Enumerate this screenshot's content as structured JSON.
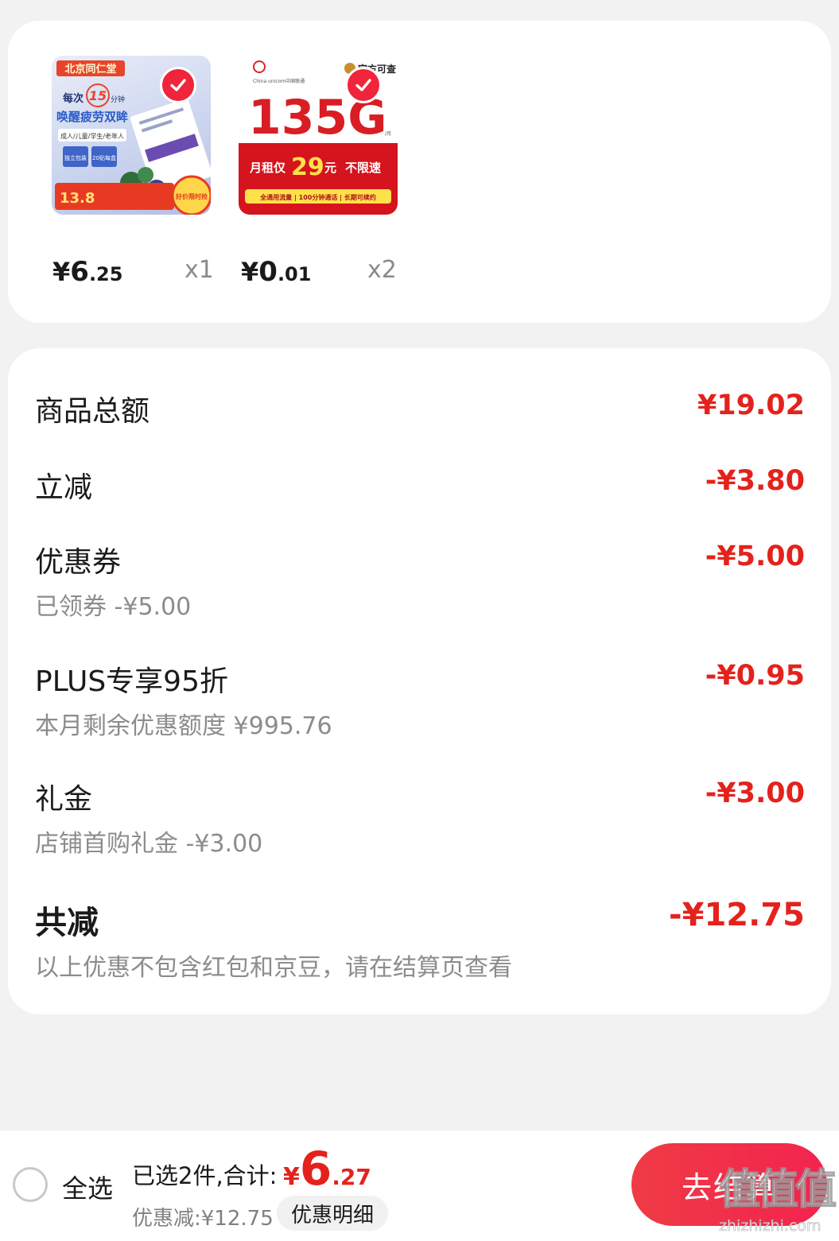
{
  "products": [
    {
      "brand_text": "北京同仁堂",
      "headline": "唤醒疲劳双眸",
      "badge": "15",
      "unit": "分钟",
      "every": "每次",
      "audience": "成人/儿童/学生/老年人",
      "pack": "独立包装",
      "count": "20贴每盒",
      "promo_price": "13.8",
      "promo_label": "好价限时抢",
      "price_symbol": "¥",
      "price_int": "6",
      "price_dec": ".25",
      "qty": "x1"
    },
    {
      "carrier": "China unicom中国联通",
      "verify": "官方可查",
      "big_text": "135G",
      "per_month": "/月",
      "rent_prefix": "月租仅",
      "rent_num": "29",
      "rent_unit": "元",
      "no_limit": "不限速",
      "footer": "全通用流量 | 100分钟通话 | 长期可续约",
      "price_symbol": "¥",
      "price_int": "0",
      "price_dec": ".01",
      "qty": "x2"
    }
  ],
  "summary": {
    "goods_total_label": "商品总额",
    "goods_total_value": "¥19.02",
    "instant_label": "立减",
    "instant_value": "-¥3.80",
    "coupon_label": "优惠券",
    "coupon_value": "-¥5.00",
    "coupon_sub": "已领券 -¥5.00",
    "plus_label": "PLUS专享95折",
    "plus_value": "-¥0.95",
    "plus_sub": "本月剩余优惠额度 ¥995.76",
    "gift_label": "礼金",
    "gift_value": "-¥3.00",
    "gift_sub": "店铺首购礼金 -¥3.00",
    "total_off_label": "共减",
    "total_off_value": "-¥12.75",
    "note": "以上优惠不包含红包和京豆，请在结算页查看"
  },
  "bottom_bar": {
    "select_all": "全选",
    "selected": "已选2件,合计:",
    "total_symbol": "¥",
    "total_int": "6",
    "total_dec": ".27",
    "discount": "优惠减:¥12.75",
    "detail_button": "优惠明细",
    "checkout_button": "去结算"
  },
  "watermark": {
    "text": "值",
    "url_text": "zhizhizhi.com"
  },
  "colors": {
    "accent": "#e4221c",
    "checkout": "#f2234f",
    "background": "#f2f2f2"
  }
}
